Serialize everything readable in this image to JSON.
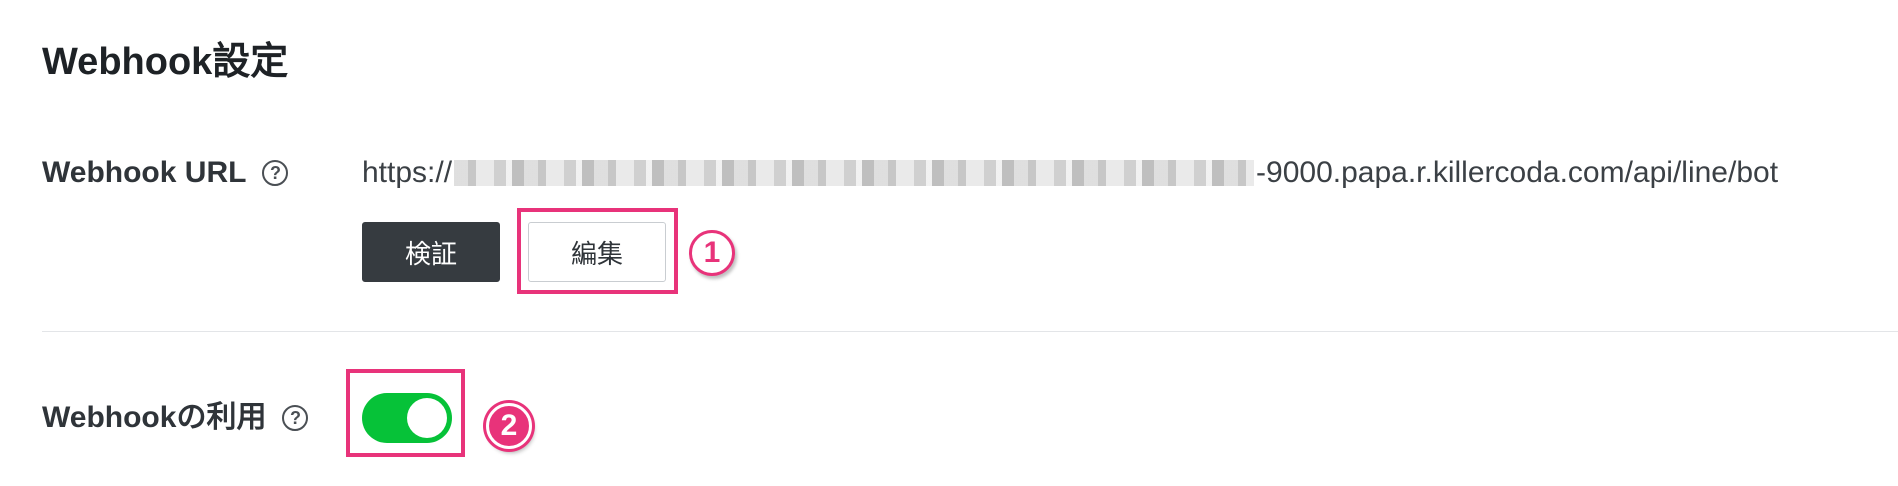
{
  "section": {
    "title": "Webhook設定"
  },
  "webhook_url": {
    "label": "Webhook URL",
    "help": "?",
    "url_prefix": "https://",
    "url_suffix": "-9000.papa.r.killercoda.com/api/line/bot",
    "verify_label": "検証",
    "edit_label": "編集"
  },
  "webhook_use": {
    "label": "Webhookの利用",
    "help": "?",
    "enabled": true
  },
  "annotations": {
    "step1": "1",
    "step2": "2"
  },
  "colors": {
    "accent_highlight": "#e8337a",
    "toggle_on": "#06c238",
    "primary_button": "#363b40"
  }
}
